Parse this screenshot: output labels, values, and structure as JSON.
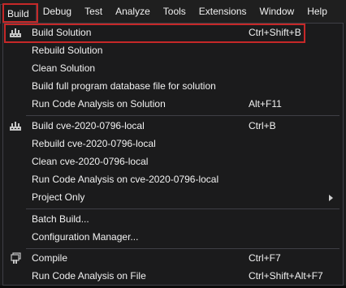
{
  "menubar": {
    "items": [
      {
        "label": "Build"
      },
      {
        "label": "Debug"
      },
      {
        "label": "Test"
      },
      {
        "label": "Analyze"
      },
      {
        "label": "Tools"
      },
      {
        "label": "Extensions"
      },
      {
        "label": "Window"
      },
      {
        "label": "Help"
      }
    ]
  },
  "menu": {
    "items": [
      {
        "label": "Build Solution",
        "shortcut": "Ctrl+Shift+B",
        "icon": "build-solution-icon"
      },
      {
        "label": "Rebuild Solution",
        "shortcut": ""
      },
      {
        "label": "Clean Solution",
        "shortcut": ""
      },
      {
        "label": "Build full program database file for solution",
        "shortcut": ""
      },
      {
        "label": "Run Code Analysis on Solution",
        "shortcut": "Alt+F11"
      },
      {
        "label": "Build cve-2020-0796-local",
        "shortcut": "Ctrl+B",
        "icon": "build-project-icon"
      },
      {
        "label": "Rebuild cve-2020-0796-local",
        "shortcut": ""
      },
      {
        "label": "Clean cve-2020-0796-local",
        "shortcut": ""
      },
      {
        "label": "Run Code Analysis on cve-2020-0796-local",
        "shortcut": ""
      },
      {
        "label": "Project Only",
        "shortcut": "",
        "submenu": true
      },
      {
        "label": "Batch Build...",
        "shortcut": ""
      },
      {
        "label": "Configuration Manager...",
        "shortcut": ""
      },
      {
        "label": "Compile",
        "shortcut": "Ctrl+F7",
        "icon": "compile-icon"
      },
      {
        "label": "Run Code Analysis on File",
        "shortcut": "Ctrl+Shift+Alt+F7"
      }
    ]
  },
  "colors": {
    "background": "#1b1b1c",
    "text": "#f1f1f1",
    "separator": "#3f3f46",
    "annotation": "#c62828"
  }
}
